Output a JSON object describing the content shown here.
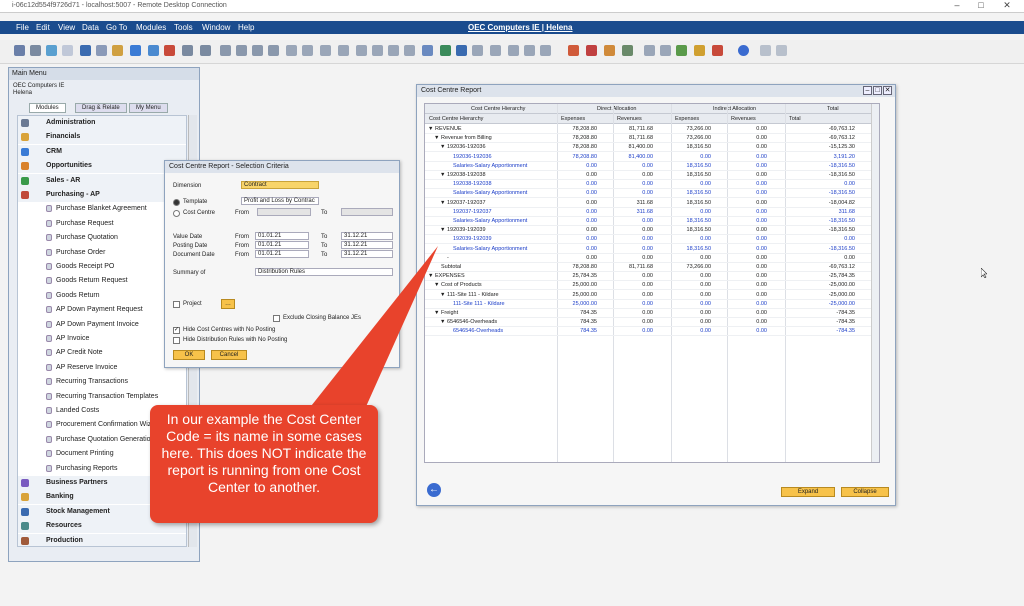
{
  "rdp": {
    "title": "i-06c12d554f9726d71 - localhost:5007 - Remote Desktop Connection"
  },
  "menu": {
    "items": [
      "File",
      "Edit",
      "View",
      "Data",
      "Go To",
      "Modules",
      "Tools",
      "Window",
      "Help"
    ],
    "title": "OEC Computers IE | Helena"
  },
  "main_menu": {
    "title": "Main Menu",
    "company": "OEC Computers IE",
    "user": "Helena",
    "tabs": [
      "Modules",
      "Drag & Relate",
      "My Menu"
    ],
    "items": [
      {
        "label": "Administration",
        "type": "module",
        "color": "#6b7a94"
      },
      {
        "label": "Financials",
        "type": "module",
        "color": "#d9a33a"
      },
      {
        "label": "CRM",
        "type": "module",
        "color": "#3a7bd5"
      },
      {
        "label": "Opportunities",
        "type": "module",
        "color": "#d9822b"
      },
      {
        "label": "Sales - AR",
        "type": "module",
        "color": "#3a9a4a"
      },
      {
        "label": "Purchasing - AP",
        "type": "module",
        "color": "#c04a3a"
      },
      {
        "label": "Purchase Blanket Agreement",
        "type": "sub"
      },
      {
        "label": "Purchase Request",
        "type": "sub"
      },
      {
        "label": "Purchase Quotation",
        "type": "sub"
      },
      {
        "label": "Purchase Order",
        "type": "sub"
      },
      {
        "label": "Goods Receipt PO",
        "type": "sub"
      },
      {
        "label": "Goods Return Request",
        "type": "sub"
      },
      {
        "label": "Goods Return",
        "type": "sub"
      },
      {
        "label": "AP Down Payment Request",
        "type": "sub"
      },
      {
        "label": "AP Down Payment Invoice",
        "type": "sub"
      },
      {
        "label": "AP Invoice",
        "type": "sub"
      },
      {
        "label": "AP Credit Note",
        "type": "sub"
      },
      {
        "label": "AP Reserve Invoice",
        "type": "sub"
      },
      {
        "label": "Recurring Transactions",
        "type": "sub"
      },
      {
        "label": "Recurring Transaction Templates",
        "type": "sub"
      },
      {
        "label": "Landed Costs",
        "type": "sub"
      },
      {
        "label": "Procurement Confirmation Wizard",
        "type": "sub"
      },
      {
        "label": "Purchase Quotation Generation Wizard",
        "type": "sub"
      },
      {
        "label": "Document Printing",
        "type": "sub"
      },
      {
        "label": "Purchasing Reports",
        "type": "sub"
      },
      {
        "label": "Business Partners",
        "type": "module",
        "color": "#7a5bc0"
      },
      {
        "label": "Banking",
        "type": "module",
        "color": "#d9a33a"
      },
      {
        "label": "Stock Management",
        "type": "module",
        "color": "#3a6bb0"
      },
      {
        "label": "Resources",
        "type": "module",
        "color": "#4a8a8a"
      },
      {
        "label": "Production",
        "type": "module",
        "color": "#a05a3a"
      }
    ]
  },
  "criteria": {
    "title": "Cost Centre Report - Selection Criteria",
    "dimension_label": "Dimension",
    "dimension_value": "Contract",
    "template_label": "Template",
    "template_value": "Profit and Loss by Contrac",
    "cost_centre_label": "Cost Centre",
    "from_label": "From",
    "to_label": "To",
    "value_date_label": "Value Date",
    "posting_date_label": "Posting Date",
    "document_date_label": "Document Date",
    "date_from": "01.01.21",
    "date_to": "31.12.21",
    "summary_label": "Summary of",
    "summary_value": "Distribution Rules",
    "project_label": "Project",
    "exclude_label": "Exclude Closing Balance JEs",
    "hide_cc_label": "Hide Cost Centres with No Posting",
    "hide_dr_label": "Hide Distribution Rules with No Posting",
    "ok_label": "OK",
    "cancel_label": "Cancel"
  },
  "report": {
    "title": "Cost Centre Report",
    "group_headers": [
      "Cost Centre Hierarchy",
      "Direct Allocation",
      "Indirect Allocation",
      "Total"
    ],
    "col_headers": [
      "Cost Centre Hierarchy",
      "Expenses",
      "Revenues",
      "Expenses",
      "Revenues",
      "Total"
    ],
    "rows": [
      {
        "label": "REVENUE",
        "indent": 0,
        "arrow": "▼",
        "blue": false,
        "v": [
          "78,208.80",
          "81,711.68",
          "73,266.00",
          "0.00",
          "-69,763.12"
        ]
      },
      {
        "label": "Revenue from Billing",
        "indent": 1,
        "arrow": "▼",
        "blue": false,
        "v": [
          "78,208.80",
          "81,711.68",
          "73,266.00",
          "0.00",
          "-69,763.12"
        ]
      },
      {
        "label": "192036-192036",
        "indent": 2,
        "arrow": "▼",
        "blue": false,
        "v": [
          "78,208.80",
          "81,400.00",
          "18,316.50",
          "0.00",
          "-15,125.30"
        ]
      },
      {
        "label": "192036-192036",
        "indent": 3,
        "arrow": "",
        "blue": true,
        "v": [
          "78,208.80",
          "81,400.00",
          "0.00",
          "0.00",
          "3,191.20"
        ]
      },
      {
        "label": "Salaries-Salary Apportionment",
        "indent": 3,
        "arrow": "",
        "blue": true,
        "v": [
          "0.00",
          "0.00",
          "18,316.50",
          "0.00",
          "-18,316.50"
        ]
      },
      {
        "label": "192038-192038",
        "indent": 2,
        "arrow": "▼",
        "blue": false,
        "v": [
          "0.00",
          "0.00",
          "18,316.50",
          "0.00",
          "-18,316.50"
        ]
      },
      {
        "label": "192038-192038",
        "indent": 3,
        "arrow": "",
        "blue": true,
        "v": [
          "0.00",
          "0.00",
          "0.00",
          "0.00",
          "0.00"
        ]
      },
      {
        "label": "Salaries-Salary Apportionment",
        "indent": 3,
        "arrow": "",
        "blue": true,
        "v": [
          "0.00",
          "0.00",
          "18,316.50",
          "0.00",
          "-18,316.50"
        ]
      },
      {
        "label": "192037-192037",
        "indent": 2,
        "arrow": "▼",
        "blue": false,
        "v": [
          "0.00",
          "311.68",
          "18,316.50",
          "0.00",
          "-18,004.82"
        ]
      },
      {
        "label": "192037-192037",
        "indent": 3,
        "arrow": "",
        "blue": true,
        "v": [
          "0.00",
          "311.68",
          "0.00",
          "0.00",
          "311.68"
        ]
      },
      {
        "label": "Salaries-Salary Apportionment",
        "indent": 3,
        "arrow": "",
        "blue": true,
        "v": [
          "0.00",
          "0.00",
          "18,316.50",
          "0.00",
          "-18,316.50"
        ]
      },
      {
        "label": "192039-192039",
        "indent": 2,
        "arrow": "▼",
        "blue": false,
        "v": [
          "0.00",
          "0.00",
          "18,316.50",
          "0.00",
          "-18,316.50"
        ]
      },
      {
        "label": "192039-192039",
        "indent": 3,
        "arrow": "",
        "blue": true,
        "v": [
          "0.00",
          "0.00",
          "0.00",
          "0.00",
          "0.00"
        ]
      },
      {
        "label": "Salaries-Salary Apportionment",
        "indent": 3,
        "arrow": "",
        "blue": true,
        "v": [
          "0.00",
          "0.00",
          "18,316.50",
          "0.00",
          "-18,316.50"
        ]
      },
      {
        "label": "-",
        "indent": 2,
        "arrow": "",
        "blue": false,
        "v": [
          "0.00",
          "0.00",
          "0.00",
          "0.00",
          "0.00"
        ]
      },
      {
        "label": "Subtotal",
        "indent": 1,
        "arrow": "",
        "blue": false,
        "v": [
          "78,208.80",
          "81,711.68",
          "73,266.00",
          "0.00",
          "-69,763.12"
        ]
      },
      {
        "label": "EXPENSES",
        "indent": 0,
        "arrow": "▼",
        "blue": false,
        "v": [
          "25,784.35",
          "0.00",
          "0.00",
          "0.00",
          "-25,784.35"
        ]
      },
      {
        "label": "Cost of Products",
        "indent": 1,
        "arrow": "▼",
        "blue": false,
        "v": [
          "25,000.00",
          "0.00",
          "0.00",
          "0.00",
          "-25,000.00"
        ]
      },
      {
        "label": "111-Site 111 - Kildare",
        "indent": 2,
        "arrow": "▼",
        "blue": false,
        "v": [
          "25,000.00",
          "0.00",
          "0.00",
          "0.00",
          "-25,000.00"
        ]
      },
      {
        "label": "111-Site 111 - Kildare",
        "indent": 3,
        "arrow": "",
        "blue": true,
        "v": [
          "25,000.00",
          "0.00",
          "0.00",
          "0.00",
          "-25,000.00"
        ]
      },
      {
        "label": "Freight",
        "indent": 1,
        "arrow": "▼",
        "blue": false,
        "v": [
          "784.35",
          "0.00",
          "0.00",
          "0.00",
          "-784.35"
        ]
      },
      {
        "label": "6546546-Overheads",
        "indent": 2,
        "arrow": "▼",
        "blue": false,
        "v": [
          "784.35",
          "0.00",
          "0.00",
          "0.00",
          "-784.35"
        ]
      },
      {
        "label": "6546546-Overheads",
        "indent": 3,
        "arrow": "",
        "blue": true,
        "v": [
          "784.35",
          "0.00",
          "0.00",
          "0.00",
          "-784.35"
        ]
      }
    ],
    "expand_label": "Expand",
    "collapse_label": "Collapse"
  },
  "callout": {
    "text": "In our example the Cost Center Code = its name in some cases here. This does NOT indicate the report is running from one Cost Center to another."
  }
}
